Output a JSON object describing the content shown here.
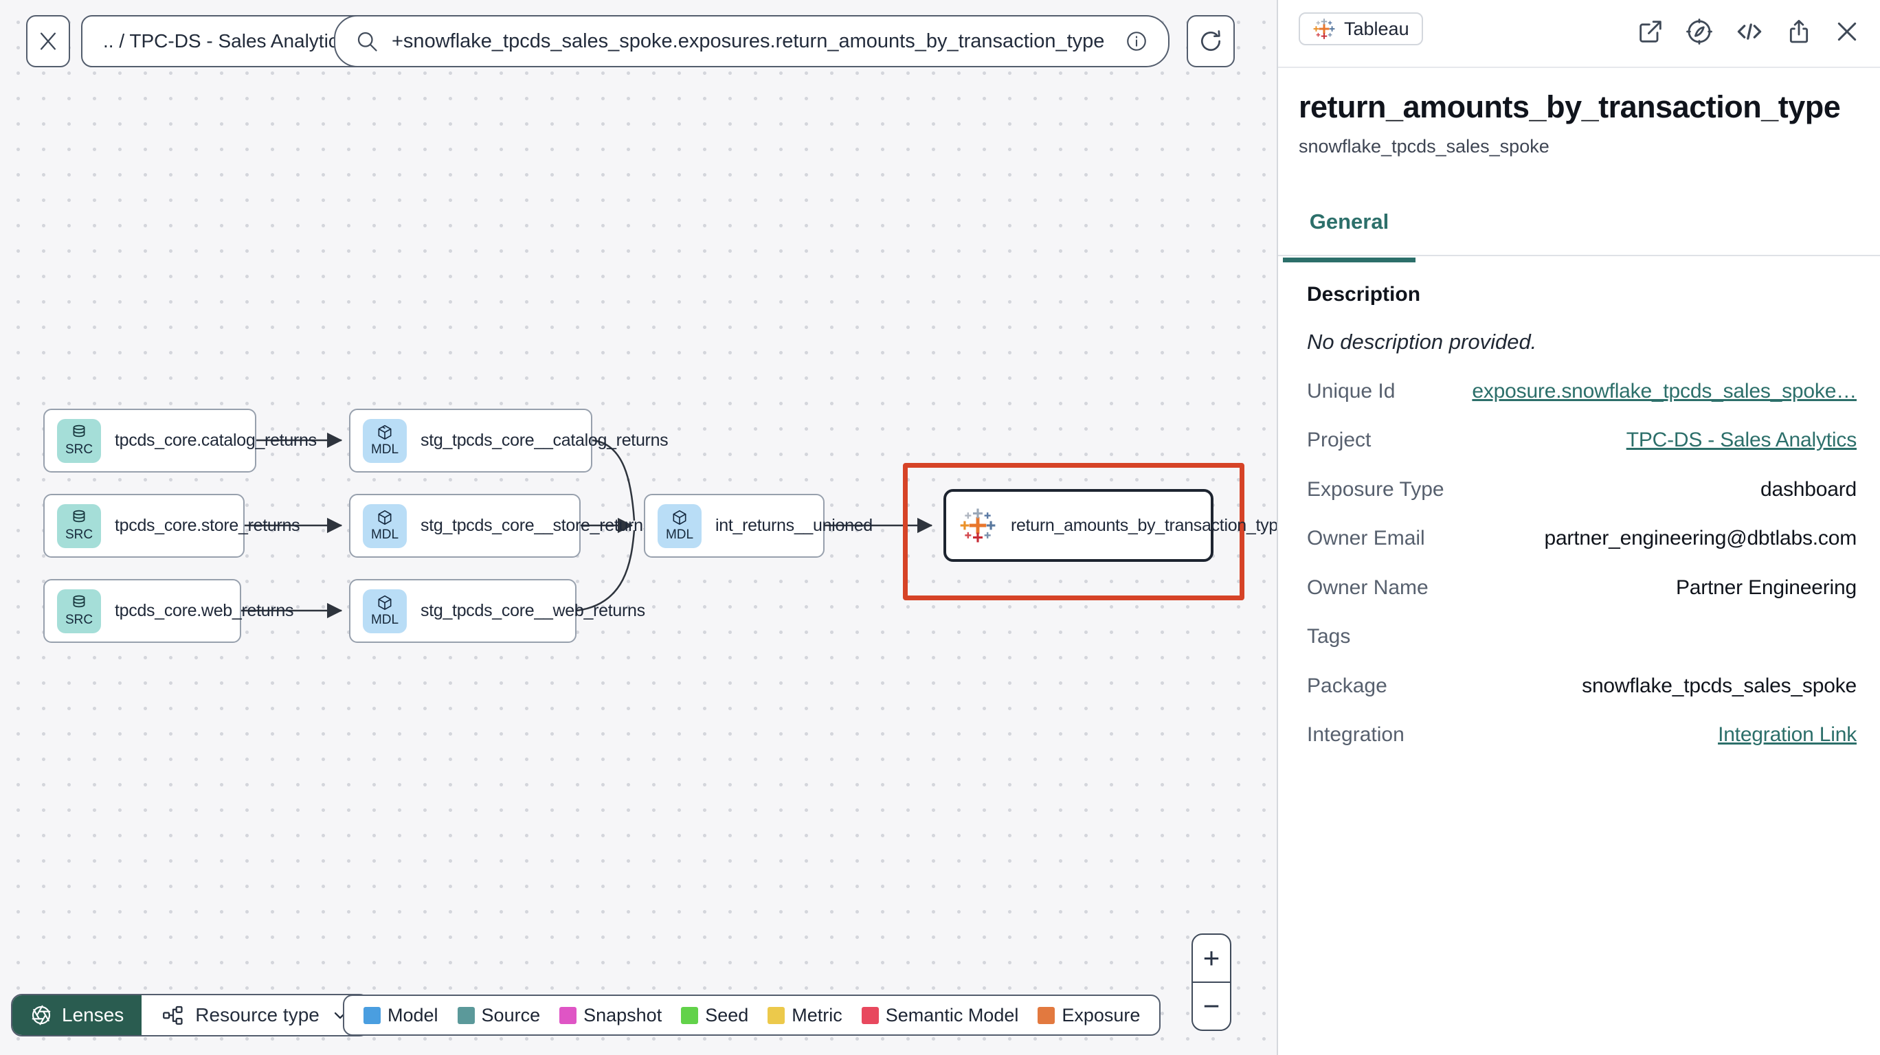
{
  "toolbar": {
    "breadcrumb": ".. / TPC-DS - Sales Analytics",
    "search_value": "+snowflake_tpcds_sales_spoke.exposures.return_amounts_by_transaction_type"
  },
  "graph": {
    "nodes": [
      {
        "chip": "SRC",
        "type": "source",
        "label": "tpcds_core.catalog_returns"
      },
      {
        "chip": "MDL",
        "type": "model",
        "label": "stg_tpcds_core__catalog_returns"
      },
      {
        "chip": "SRC",
        "type": "source",
        "label": "tpcds_core.store_returns"
      },
      {
        "chip": "MDL",
        "type": "model",
        "label": "stg_tpcds_core__store_returns"
      },
      {
        "chip": "SRC",
        "type": "source",
        "label": "tpcds_core.web_returns"
      },
      {
        "chip": "MDL",
        "type": "model",
        "label": "stg_tpcds_core__web_returns"
      },
      {
        "chip": "MDL",
        "type": "model",
        "label": "int_returns__unioned"
      },
      {
        "chip": "",
        "type": "exposure",
        "label": "return_amounts_by_transaction_type"
      }
    ],
    "lenses_label": "Lenses",
    "resource_type_label": "Resource type",
    "zoom_in": "+",
    "zoom_out": "−",
    "legend": {
      "items": [
        {
          "label": "Model",
          "color": "#4a9ee0"
        },
        {
          "label": "Source",
          "color": "#5b999a"
        },
        {
          "label": "Snapshot",
          "color": "#df55c5"
        },
        {
          "label": "Seed",
          "color": "#62d24a"
        },
        {
          "label": "Metric",
          "color": "#ecc94b"
        },
        {
          "label": "Semantic Model",
          "color": "#e8485e"
        },
        {
          "label": "Exposure",
          "color": "#e2793f"
        }
      ]
    }
  },
  "panel": {
    "badge": "Tableau",
    "title": "return_amounts_by_transaction_type",
    "subtitle": "snowflake_tpcds_sales_spoke",
    "tab": "General",
    "description_label": "Description",
    "description_value": "No description provided.",
    "fields": [
      {
        "label": "Unique Id",
        "value": "exposure.snowflake_tpcds_sales_spoke…",
        "link": true
      },
      {
        "label": "Project",
        "value": "TPC-DS - Sales Analytics",
        "link": true
      },
      {
        "label": "Exposure Type",
        "value": "dashboard",
        "link": false
      },
      {
        "label": "Owner Email",
        "value": "partner_engineering@dbtlabs.com",
        "link": false
      },
      {
        "label": "Owner Name",
        "value": "Partner Engineering",
        "link": false
      },
      {
        "label": "Tags",
        "value": "",
        "link": false
      },
      {
        "label": "Package",
        "value": "snowflake_tpcds_sales_spoke",
        "link": false
      },
      {
        "label": "Integration",
        "value": "Integration Link",
        "link": true
      }
    ]
  },
  "icons": [
    "close-icon",
    "search-icon",
    "info-icon",
    "refresh-icon",
    "database-icon",
    "cube-icon",
    "tableau-logo-icon",
    "aperture-icon",
    "resource-tree-icon",
    "chevron-down-icon",
    "external-link-icon",
    "compass-icon",
    "code-icon",
    "share-icon",
    "plus-icon",
    "minus-icon"
  ],
  "colors": {
    "accent_teal": "#2c6f6a",
    "highlight_red": "#d64327",
    "lenses_green": "#2a5c50",
    "source_chip": "#a5ded8",
    "model_chip": "#b9ddf6",
    "canvas_bg": "#f6f6f8"
  }
}
